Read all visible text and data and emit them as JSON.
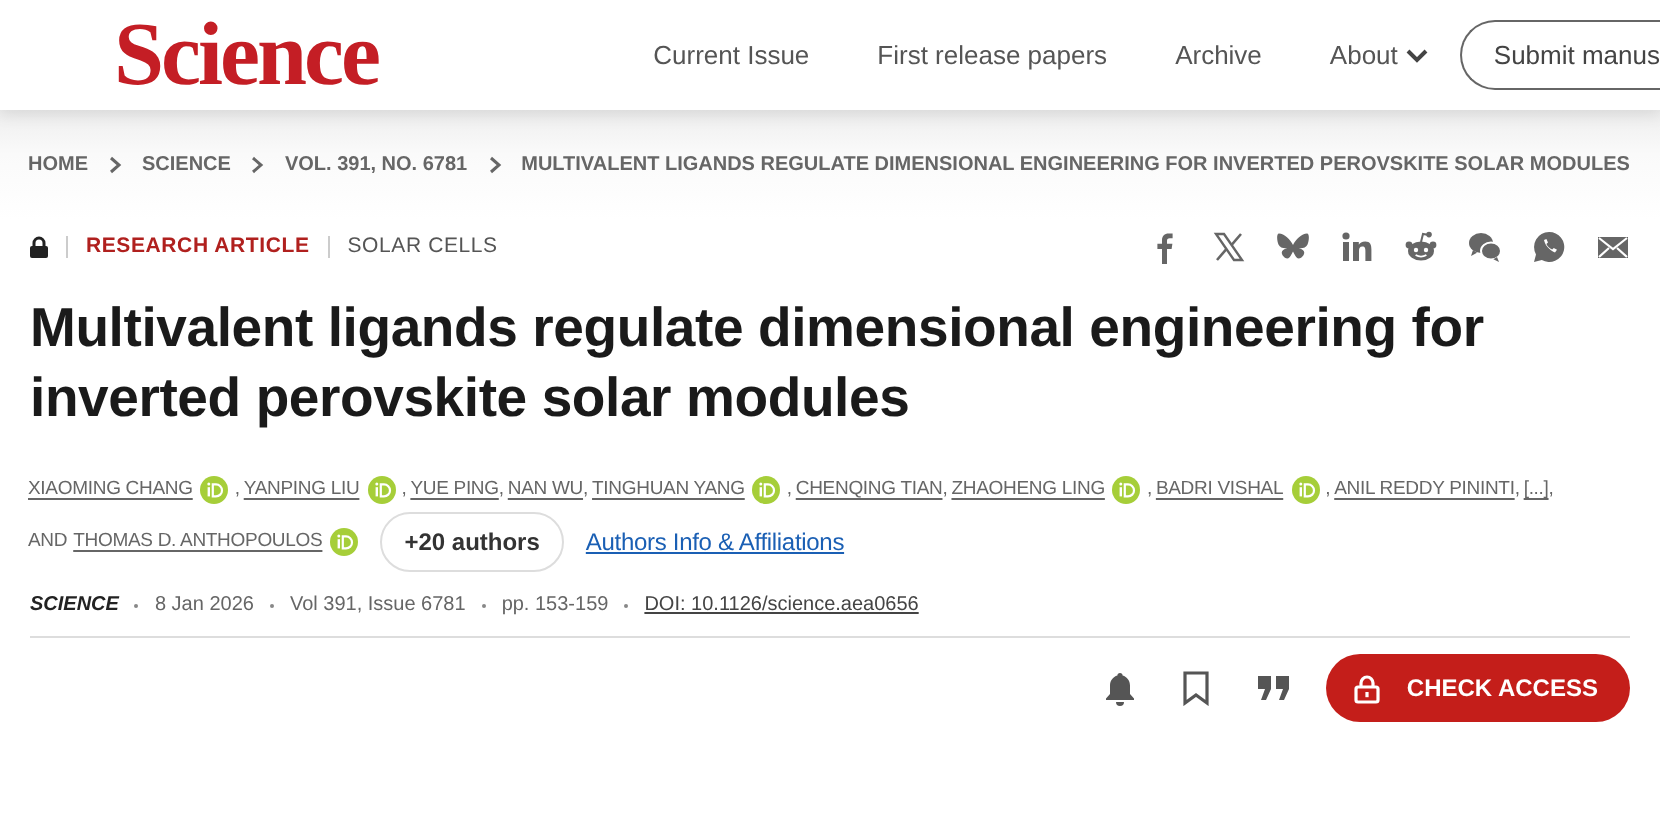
{
  "header": {
    "logo": "Science",
    "nav": [
      {
        "label": "Current Issue",
        "kind": "link"
      },
      {
        "label": "First release papers",
        "kind": "link"
      },
      {
        "label": "Archive",
        "kind": "link"
      },
      {
        "label": "About",
        "kind": "dropdown"
      }
    ],
    "submit_button": "Submit manus"
  },
  "breadcrumb": [
    "HOME",
    "SCIENCE",
    "VOL. 391, NO. 6781",
    "MULTIVALENT LIGANDS REGULATE DIMENSIONAL ENGINEERING FOR INVERTED PEROVSKITE SOLAR MODULES"
  ],
  "article": {
    "locked": true,
    "type": "RESEARCH ARTICLE",
    "section": "SOLAR CELLS",
    "title": "Multivalent ligands regulate dimensional engineering for inverted perovskite solar modules",
    "authors": [
      {
        "name": "XIAOMING CHANG",
        "orcid": true,
        "separator": ","
      },
      {
        "name": "YANPING LIU",
        "orcid": true,
        "separator": ","
      },
      {
        "name": "YUE PING",
        "orcid": false,
        "separator": ","
      },
      {
        "name": "NAN WU",
        "orcid": false,
        "separator": ","
      },
      {
        "name": "TINGHUAN YANG",
        "orcid": true,
        "separator": ","
      },
      {
        "name": "CHENQING TIAN",
        "orcid": false,
        "separator": ","
      },
      {
        "name": "ZHAOHENG LING",
        "orcid": true,
        "separator": ","
      },
      {
        "name": "BADRI VISHAL",
        "orcid": true,
        "separator": ","
      },
      {
        "name": "ANIL REDDY PININTI",
        "orcid": false,
        "separator": ","
      },
      {
        "name": "[...]",
        "orcid": false,
        "separator": ","
      }
    ],
    "conjunction": "AND",
    "last_author": {
      "name": "THOMAS D. ANTHOPOULOS",
      "orcid": true
    },
    "more_authors_button": "+20 authors",
    "affiliations_link": "Authors Info & Affiliations",
    "meta": {
      "journal": "SCIENCE",
      "date": "8 Jan 2026",
      "issue": "Vol 391, Issue 6781",
      "pages": "pp. 153-159",
      "doi": "DOI: 10.1126/science.aea0656"
    },
    "check_access_button": "CHECK ACCESS"
  }
}
